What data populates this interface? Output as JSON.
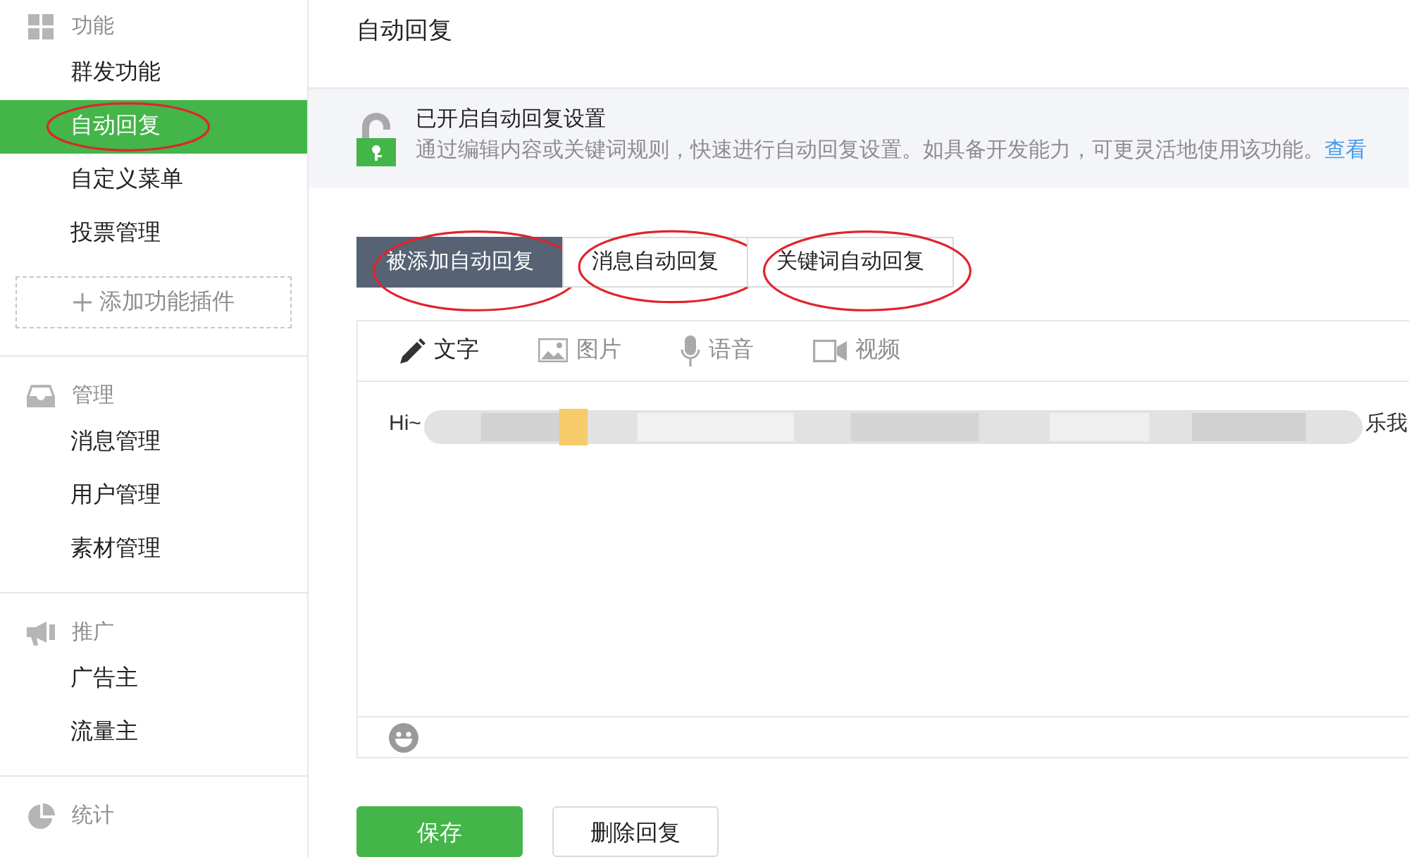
{
  "sidebar": {
    "groups": [
      {
        "title": "功能",
        "items": [
          {
            "label": "群发功能",
            "selected": false,
            "circled": false
          },
          {
            "label": "自动回复",
            "selected": true,
            "circled": true
          },
          {
            "label": "自定义菜单",
            "selected": false,
            "circled": false
          },
          {
            "label": "投票管理",
            "selected": false,
            "circled": false
          }
        ],
        "add_button": "添加功能插件"
      },
      {
        "title": "管理",
        "items": [
          {
            "label": "消息管理",
            "selected": false,
            "circled": false
          },
          {
            "label": "用户管理",
            "selected": false,
            "circled": false
          },
          {
            "label": "素材管理",
            "selected": false,
            "circled": false
          }
        ]
      },
      {
        "title": "推广",
        "items": [
          {
            "label": "广告主",
            "selected": false,
            "circled": false
          },
          {
            "label": "流量主",
            "selected": false,
            "circled": false
          }
        ]
      },
      {
        "title": "统计"
      }
    ]
  },
  "page_title": "自动回复",
  "notice": {
    "title": "已开启自动回复设置",
    "text": "通过编辑内容或关键词规则，快速进行自动回复设置。如具备开发能力，可更灵活地使用该功能。",
    "link": "查看"
  },
  "tabs": [
    {
      "label": "被添加自动回复",
      "selected": true,
      "circled": true
    },
    {
      "label": "消息自动回复",
      "selected": false,
      "circled": true
    },
    {
      "label": "关键词自动回复",
      "selected": false,
      "circled": true
    }
  ],
  "editor": {
    "tools": [
      {
        "label": "文字",
        "selected": true
      },
      {
        "label": "图片",
        "selected": false
      },
      {
        "label": "语音",
        "selected": false
      },
      {
        "label": "视频",
        "selected": false
      }
    ],
    "content_start": "Hi~",
    "content_end": "乐我"
  },
  "buttons": [
    {
      "label": "保存",
      "kind": "primary"
    },
    {
      "label": "删除回复",
      "kind": "default"
    }
  ]
}
